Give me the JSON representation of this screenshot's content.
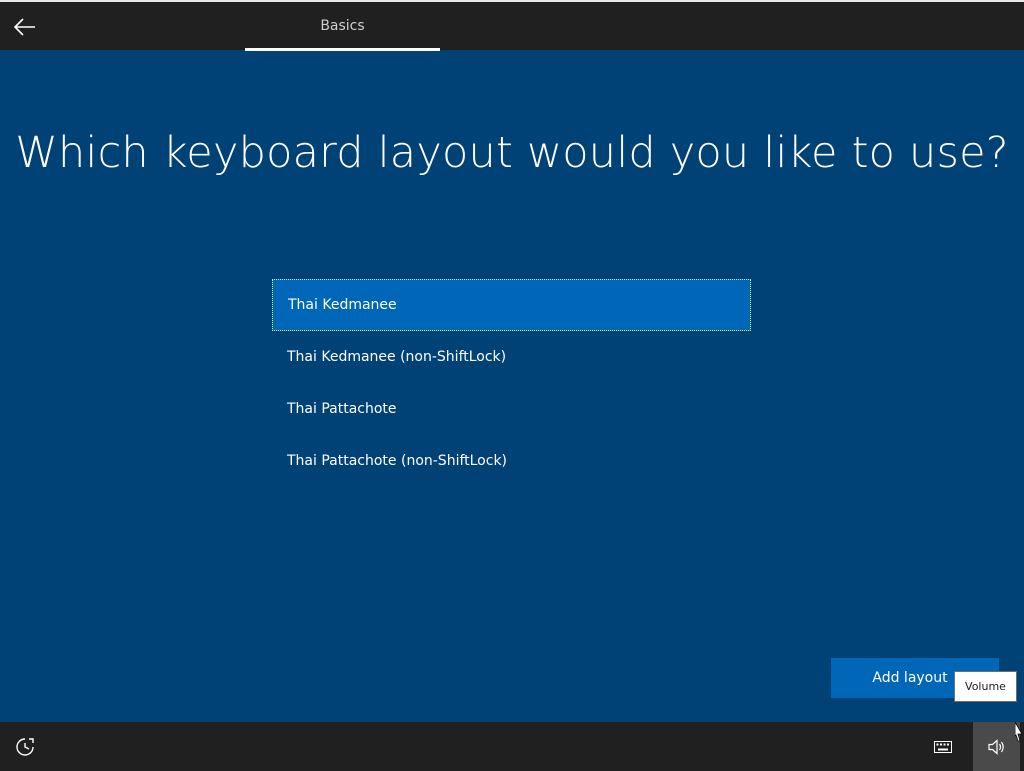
{
  "header": {
    "tab_label": "Basics"
  },
  "page": {
    "title": "Which keyboard layout would you like to use?"
  },
  "layouts": [
    {
      "label": "Thai Kedmanee",
      "selected": true
    },
    {
      "label": "Thai Kedmanee (non-ShiftLock)",
      "selected": false
    },
    {
      "label": "Thai Pattachote",
      "selected": false
    },
    {
      "label": "Thai Pattachote (non-ShiftLock)",
      "selected": false
    }
  ],
  "actions": {
    "add_layout_label": "Add layout"
  },
  "tooltip": {
    "volume_label": "Volume"
  },
  "colors": {
    "background": "#004275",
    "accent": "#0067b8",
    "bar": "#202020"
  },
  "icons": {
    "back": "arrow-left-icon",
    "ease_of_access": "ease-of-access-icon",
    "keyboard": "keyboard-icon",
    "volume": "speaker-icon"
  }
}
